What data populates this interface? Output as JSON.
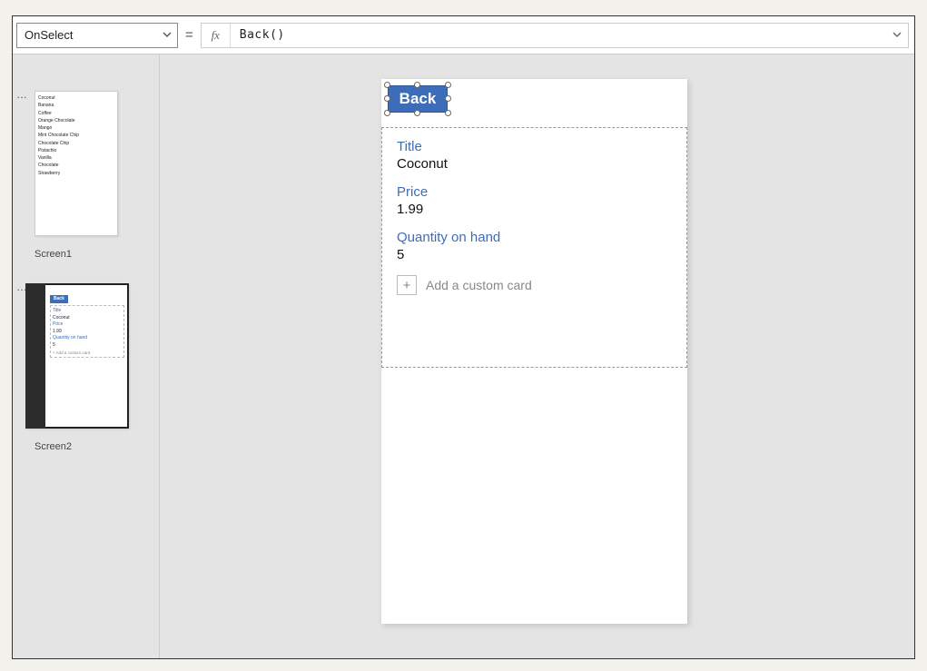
{
  "formula_bar": {
    "property": "OnSelect",
    "fx_label": "fx",
    "expression": "Back()"
  },
  "sidebar": {
    "screens": [
      {
        "name": "Screen1",
        "selected": false
      },
      {
        "name": "Screen2",
        "selected": true
      }
    ],
    "screen1_preview_items": [
      "Coconut",
      "Banana",
      "Coffee",
      "Orange Chocolate",
      "Mango",
      "Mint Chocolate Chip",
      "Chocolate Chip",
      "Pistachio",
      "Vanilla",
      "Chocolate",
      "Strawberry"
    ],
    "screen2_preview": {
      "back": "Back",
      "fields": [
        {
          "label": "Title",
          "value": "Coconut"
        },
        {
          "label": "Price",
          "value": "1.99"
        },
        {
          "label": "Quantity on hand",
          "value": "5"
        }
      ],
      "add_card": "+   Add a custom card"
    }
  },
  "canvas": {
    "back_button": "Back",
    "form": {
      "fields": [
        {
          "label": "Title",
          "value": "Coconut"
        },
        {
          "label": "Price",
          "value": "1.99"
        },
        {
          "label": "Quantity on hand",
          "value": "5"
        }
      ],
      "add_custom_card": "Add a custom card"
    }
  }
}
